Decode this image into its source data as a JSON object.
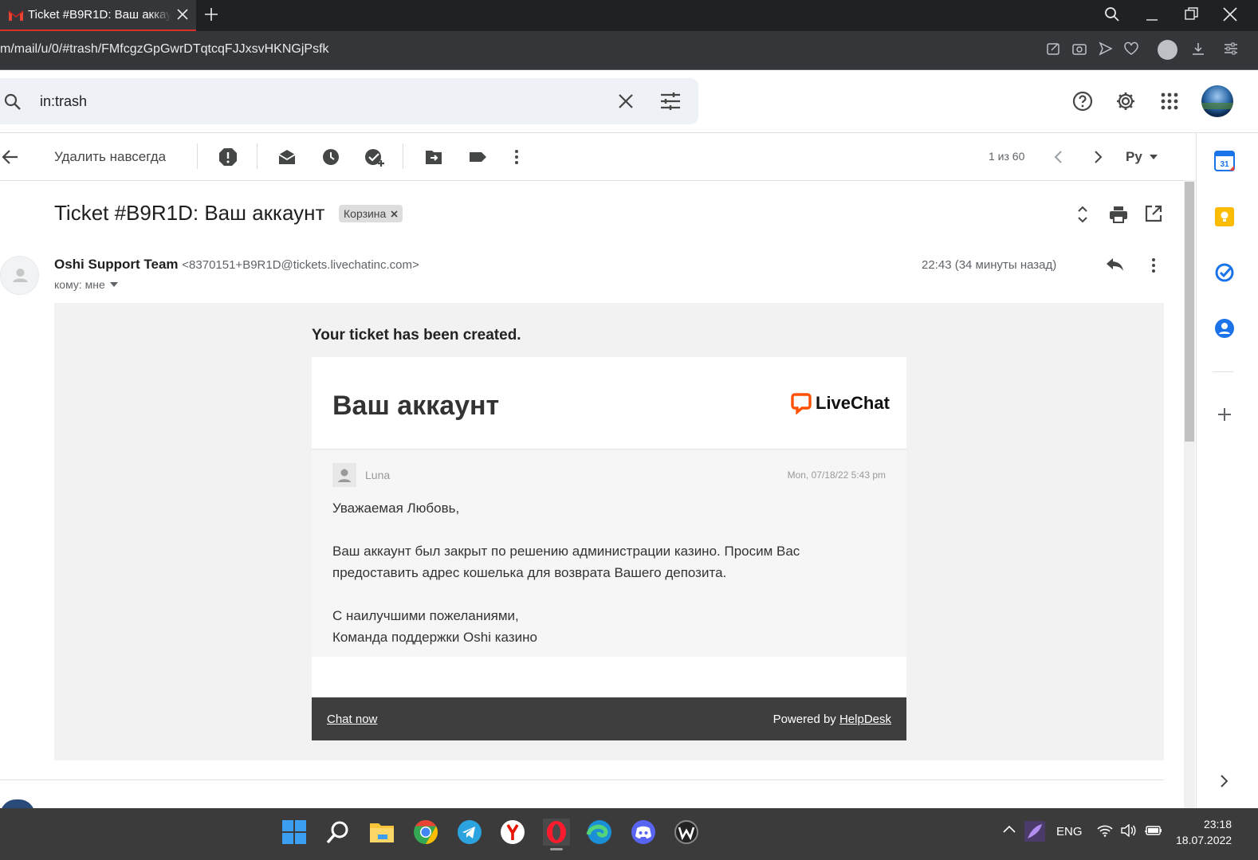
{
  "browser": {
    "tab_title": "Ticket #B9R1D: Ваш аккаунт",
    "url": "m/mail/u/0/#trash/FMfcgzGpGwrDTqtcqFJJxsvHKNGjPsfk"
  },
  "search": {
    "query": "in:trash"
  },
  "toolbar": {
    "delete_forever": "Удалить навсегда",
    "pager": "1 из 60",
    "input_lang": "Ру"
  },
  "email": {
    "subject": "Ticket #B9R1D: Ваш аккаунт",
    "label": "Корзина",
    "sender_name": "Oshi Support Team",
    "sender_address": "<8370151+B9R1D@tickets.livechatinc.com>",
    "to": "кому: мне",
    "time": "22:43 (34 минуты назад)"
  },
  "body": {
    "intro": "Your ticket has been created.",
    "card_title": "Ваш аккаунт",
    "brand": "LiveChat",
    "agent_name": "Luna",
    "message_date": "Mon, 07/18/22 5:43 pm",
    "greeting": "Уважаемая Любовь,",
    "paragraph": "Ваш аккаунт был закрыт по решению администрации казино. Просим Вас предоставить адрес кошелька для возврата Вашего депозита.",
    "closing_1": "С наилучшими пожеланиями,",
    "closing_2": "Команда поддержки Oshi казино",
    "chat_now": "Chat now",
    "powered_by": "Powered by",
    "powered_brand": "HelpDesk"
  },
  "taskbar": {
    "lang": "ENG",
    "time": "23:18",
    "date": "18.07.2022"
  },
  "colors": {
    "gmail_red": "#d93025",
    "livechat_orange": "#ff5100",
    "footer_bg": "#3e3e3e",
    "calendar_blue": "#1a73e8",
    "keep_yellow": "#fbbc04"
  }
}
